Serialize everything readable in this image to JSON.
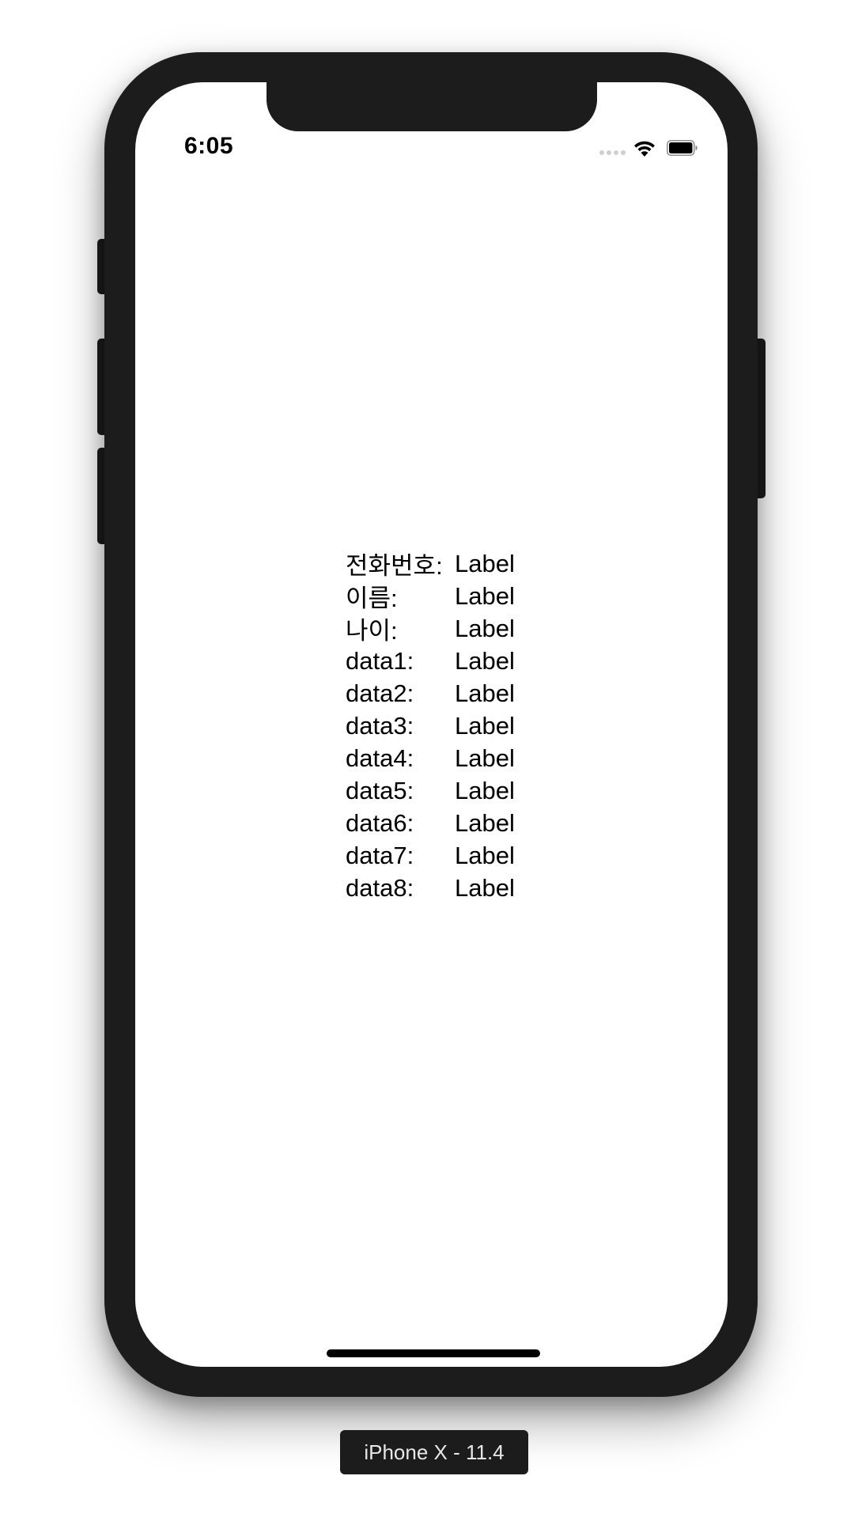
{
  "status_bar": {
    "time": "6:05",
    "icons": [
      "cellular-signal-icon",
      "wifi-icon",
      "battery-icon"
    ]
  },
  "rows": [
    {
      "key": "전화번호:",
      "value": "Label"
    },
    {
      "key": "이름:",
      "value": "Label"
    },
    {
      "key": "나이:",
      "value": "Label"
    },
    {
      "key": "data1:",
      "value": "Label"
    },
    {
      "key": "data2:",
      "value": "Label"
    },
    {
      "key": "data3:",
      "value": "Label"
    },
    {
      "key": "data4:",
      "value": "Label"
    },
    {
      "key": "data5:",
      "value": "Label"
    },
    {
      "key": "data6:",
      "value": "Label"
    },
    {
      "key": "data7:",
      "value": "Label"
    },
    {
      "key": "data8:",
      "value": "Label"
    }
  ],
  "device_label": "iPhone X - 11.4",
  "colors": {
    "device_frame": "#1c1c1c",
    "screen_background": "#ffffff",
    "text": "#000000"
  }
}
